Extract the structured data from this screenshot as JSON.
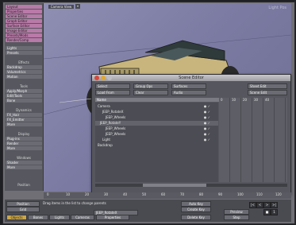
{
  "viewport": {
    "tab_label": "Camera View",
    "corner_label": "Light Pos"
  },
  "sidebar": {
    "items": [
      {
        "label": "Layout",
        "color": "pink"
      },
      {
        "label": "Properties",
        "color": "pink"
      },
      {
        "label": "Scene Editor",
        "color": "pink"
      },
      {
        "label": "Graph Editor",
        "color": "pink"
      },
      {
        "label": "Surface Editor",
        "color": "pink"
      },
      {
        "label": "Image Editor",
        "color": "pink"
      },
      {
        "label": "Presets/Mods",
        "color": "pink"
      },
      {
        "label": "Render/Comp",
        "color": "pink"
      },
      {
        "label": "Lights",
        "color": "gray"
      },
      {
        "label": "Presets",
        "color": "gray"
      }
    ],
    "sections": [
      {
        "label": "Effects",
        "items": [
          "Backdrop",
          "Volumetrics",
          "Motion"
        ]
      },
      {
        "label": "Tools",
        "items": [
          "Apply/Morph",
          "Edit/Tools",
          "Bone"
        ]
      },
      {
        "label": "Dynamics",
        "items": [
          "FX_Hair",
          "FX_Emitter",
          "More"
        ]
      },
      {
        "label": "Display",
        "items": [
          "Plug-ins",
          "Render",
          "More"
        ]
      },
      {
        "label": "Windows",
        "items": [
          "Shader",
          "More"
        ]
      },
      {
        "label": "Position",
        "items": []
      }
    ]
  },
  "scene_editor": {
    "title": "Scene Editor",
    "dropdowns": [
      "Select",
      "Group Ops",
      "Surfaces",
      "Load From",
      "Clear",
      "Audio"
    ],
    "right_dropdowns": [
      "Sheet Edit",
      "Scene Edit"
    ],
    "header": "Name",
    "rows": [
      "Camera",
      "JEEP_RotateX",
      "JEEP_Wheels",
      "JEEP_RotateY",
      "JEEP_Wheels",
      "JEEP_Wheels",
      "Light",
      "Backdrop"
    ],
    "timeline_ticks": [
      "0",
      "10",
      "20",
      "30",
      "40"
    ]
  },
  "timeline": {
    "ticks": [
      "0",
      "10",
      "20",
      "30",
      "40",
      "50",
      "60",
      "70",
      "80",
      "90",
      "100",
      "110",
      "120"
    ]
  },
  "bottom": {
    "position": "Position",
    "grid": "Grid",
    "message": "Drag items in the list to change parents",
    "current_item": "JEEP_RotateX",
    "buttons": [
      "Objects",
      "Bones",
      "Lights",
      "Cameras",
      "Properties"
    ],
    "right_buttons": [
      "Auto Key",
      "Create Key",
      "Delete Key",
      "Preview",
      "Step"
    ],
    "transport": [
      "|<",
      "<",
      ">",
      ">|",
      "■",
      "1"
    ]
  }
}
